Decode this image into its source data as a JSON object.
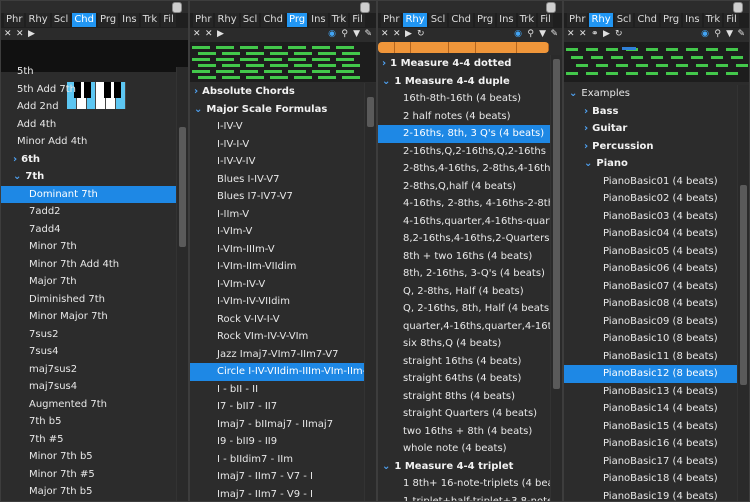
{
  "panel1": {
    "tabs": [
      "Phr",
      "Rhy",
      "Scl",
      "Chd",
      "Prg",
      "Ins",
      "Trk",
      "Fil"
    ],
    "active_tab": "Chd",
    "rows": [
      {
        "label": "5th",
        "indent": 1
      },
      {
        "label": "5th Add 7th",
        "indent": 1
      },
      {
        "label": "Add 2nd",
        "indent": 1
      },
      {
        "label": "Add 4th",
        "indent": 1
      },
      {
        "label": "Minor Add 4th",
        "indent": 1
      },
      {
        "label": "6th",
        "indent": 0,
        "chev": "›",
        "bold": true
      },
      {
        "label": "7th",
        "indent": 0,
        "chev": "⌄",
        "bold": true
      },
      {
        "label": "Dominant 7th",
        "indent": 2,
        "selected": true
      },
      {
        "label": "7add2",
        "indent": 2
      },
      {
        "label": "7add4",
        "indent": 2
      },
      {
        "label": "Minor 7th",
        "indent": 2
      },
      {
        "label": "Minor 7th Add 4th",
        "indent": 2
      },
      {
        "label": "Major 7th",
        "indent": 2
      },
      {
        "label": "Diminished 7th",
        "indent": 2
      },
      {
        "label": "Minor Major 7th",
        "indent": 2
      },
      {
        "label": "7sus2",
        "indent": 2
      },
      {
        "label": "7sus4",
        "indent": 2
      },
      {
        "label": "maj7sus2",
        "indent": 2
      },
      {
        "label": "maj7sus4",
        "indent": 2
      },
      {
        "label": "Augmented 7th",
        "indent": 2
      },
      {
        "label": "7th b5",
        "indent": 2
      },
      {
        "label": "7th #5",
        "indent": 2
      },
      {
        "label": "Minor 7th b5",
        "indent": 2
      },
      {
        "label": "Minor 7th #5",
        "indent": 2
      },
      {
        "label": "Major 7th b5",
        "indent": 2
      }
    ]
  },
  "panel2": {
    "tabs": [
      "Phr",
      "Rhy",
      "Scl",
      "Chd",
      "Prg",
      "Ins",
      "Trk",
      "Fil"
    ],
    "active_tab": "Prg",
    "rows": [
      {
        "label": "Absolute Chords",
        "indent": 0,
        "chev": "›",
        "bold": true
      },
      {
        "label": "Major Scale Formulas",
        "indent": 0,
        "chev": "⌄",
        "bold": true
      },
      {
        "label": "I-IV-V",
        "indent": 1
      },
      {
        "label": "I-IV-I-V",
        "indent": 1
      },
      {
        "label": "I-IV-V-IV",
        "indent": 1
      },
      {
        "label": "Blues I-IV-V7",
        "indent": 1
      },
      {
        "label": "Blues I7-IV7-V7",
        "indent": 1
      },
      {
        "label": "I-IIm-V",
        "indent": 1
      },
      {
        "label": "I-VIm-V",
        "indent": 1
      },
      {
        "label": "I-VIm-IIIm-V",
        "indent": 1
      },
      {
        "label": "I-VIm-IIm-VIIdim",
        "indent": 1
      },
      {
        "label": "I-VIm-IV-V",
        "indent": 1
      },
      {
        "label": "I-VIm-IV-VIIdim",
        "indent": 1
      },
      {
        "label": "Rock V-IV-I-V",
        "indent": 1
      },
      {
        "label": "Rock VIm-IV-V-VIm",
        "indent": 1
      },
      {
        "label": "Jazz Imaj7-VIm7-IIm7-V7",
        "indent": 1
      },
      {
        "label": "Circle I-IV-VIIdim-IIIm-VIm-IIm-V-I",
        "indent": 1,
        "selected": true
      },
      {
        "label": "I - bII - II",
        "indent": 1
      },
      {
        "label": "I7 - bII7 - II7",
        "indent": 1
      },
      {
        "label": "Imaj7 - bIImaj7 - IImaj7",
        "indent": 1
      },
      {
        "label": "I9 - bII9 - II9",
        "indent": 1
      },
      {
        "label": "I - bIIdim7 - IIm",
        "indent": 1
      },
      {
        "label": "Imaj7 - IIm7 - V7 - I",
        "indent": 1
      },
      {
        "label": "Imaj7 - IIm7 - V9 - I",
        "indent": 1
      }
    ]
  },
  "panel3": {
    "tabs": [
      "Phr",
      "Rhy",
      "Scl",
      "Chd",
      "Prg",
      "Ins",
      "Trk",
      "Fil"
    ],
    "active_tab": "Rhy",
    "rows": [
      {
        "label": "1 Measure 4-4 dotted",
        "indent": 0,
        "chev": "›",
        "bold": true
      },
      {
        "label": "1 Measure 4-4 duple",
        "indent": 0,
        "chev": "⌄",
        "bold": true
      },
      {
        "label": "16th-8th-16th (4 beats)",
        "indent": 1
      },
      {
        "label": "2 half notes (4 beats)",
        "indent": 1
      },
      {
        "label": "2-16ths, 8th, 3 Q's (4 beats)",
        "indent": 1,
        "selected": true
      },
      {
        "label": "2-16ths,Q,2-16ths,Q,2-16ths",
        "indent": 1
      },
      {
        "label": "2-8ths,4-16ths, 2-8ths,4-16ths (4 b",
        "indent": 1
      },
      {
        "label": "2-8ths,Q,half (4 beats)",
        "indent": 1
      },
      {
        "label": "4-16ths, 2-8ths, 4-16ths-2-8ths (4 b",
        "indent": 1
      },
      {
        "label": "4-16ths,quarter,4-16ths-quarter (4 b",
        "indent": 1
      },
      {
        "label": "8,2-16ths,4-16ths,2-Quarters (4 beat",
        "indent": 1
      },
      {
        "label": "8th + two 16ths (4 beats)",
        "indent": 1
      },
      {
        "label": "8th, 2-16ths, 3-Q's (4 beats)",
        "indent": 1
      },
      {
        "label": "Q, 2-8ths, Half (4 beats)",
        "indent": 1
      },
      {
        "label": "Q, 2-16ths, 8th, Half (4 beats)",
        "indent": 1
      },
      {
        "label": "quarter,4-16ths,quarter,4-16ths (4 be",
        "indent": 1
      },
      {
        "label": "six 8ths,Q (4 beats)",
        "indent": 1
      },
      {
        "label": "straight 16ths (4 beats)",
        "indent": 1
      },
      {
        "label": "straight 64ths (4 beats)",
        "indent": 1
      },
      {
        "label": "straight 8ths (4 beats)",
        "indent": 1
      },
      {
        "label": "straight Quarters (4 beats)",
        "indent": 1
      },
      {
        "label": "two 16ths + 8th (4 beats)",
        "indent": 1
      },
      {
        "label": "whole note (4 beats)",
        "indent": 1
      },
      {
        "label": "1 Measure 4-4 triplet",
        "indent": 0,
        "chev": "⌄",
        "bold": true
      },
      {
        "label": "1 8th+ 16-note-triplets (4 beats)",
        "indent": 1
      },
      {
        "label": "1 triplet+half-triplet+3 8-note-triplet",
        "indent": 1
      }
    ]
  },
  "panel4": {
    "tabs": [
      "Phr",
      "Rhy",
      "Scl",
      "Chd",
      "Prg",
      "Ins",
      "Trk",
      "Fil"
    ],
    "active_tab": "Rhy",
    "rows": [
      {
        "label": "Examples",
        "indent": 0,
        "chev": "⌄"
      },
      {
        "label": "Bass",
        "indent": 1,
        "chev": "›",
        "bold": true
      },
      {
        "label": "Guitar",
        "indent": 1,
        "chev": "›",
        "bold": true
      },
      {
        "label": "Percussion",
        "indent": 1,
        "chev": "›",
        "bold": true
      },
      {
        "label": "Piano",
        "indent": 1,
        "chev": "⌄",
        "bold": true
      },
      {
        "label": "PianoBasic01 (4 beats)",
        "indent": 2
      },
      {
        "label": "PianoBasic02 (4 beats)",
        "indent": 2
      },
      {
        "label": "PianoBasic03 (4 beats)",
        "indent": 2
      },
      {
        "label": "PianoBasic04 (4 beats)",
        "indent": 2
      },
      {
        "label": "PianoBasic05 (4 beats)",
        "indent": 2
      },
      {
        "label": "PianoBasic06 (4 beats)",
        "indent": 2
      },
      {
        "label": "PianoBasic07 (4 beats)",
        "indent": 2
      },
      {
        "label": "PianoBasic08 (4 beats)",
        "indent": 2
      },
      {
        "label": "PianoBasic09 (8 beats)",
        "indent": 2
      },
      {
        "label": "PianoBasic10 (8 beats)",
        "indent": 2
      },
      {
        "label": "PianoBasic11 (8 beats)",
        "indent": 2
      },
      {
        "label": "PianoBasic12 (8 beats)",
        "indent": 2,
        "selected": true
      },
      {
        "label": "PianoBasic13 (4 beats)",
        "indent": 2
      },
      {
        "label": "PianoBasic14 (4 beats)",
        "indent": 2
      },
      {
        "label": "PianoBasic15 (4 beats)",
        "indent": 2
      },
      {
        "label": "PianoBasic16 (4 beats)",
        "indent": 2
      },
      {
        "label": "PianoBasic17 (4 beats)",
        "indent": 2
      },
      {
        "label": "PianoBasic18 (4 beats)",
        "indent": 2
      },
      {
        "label": "PianoBasic19 (4 beats)",
        "indent": 2
      }
    ]
  },
  "watermark": "FLYING-DAD.com"
}
